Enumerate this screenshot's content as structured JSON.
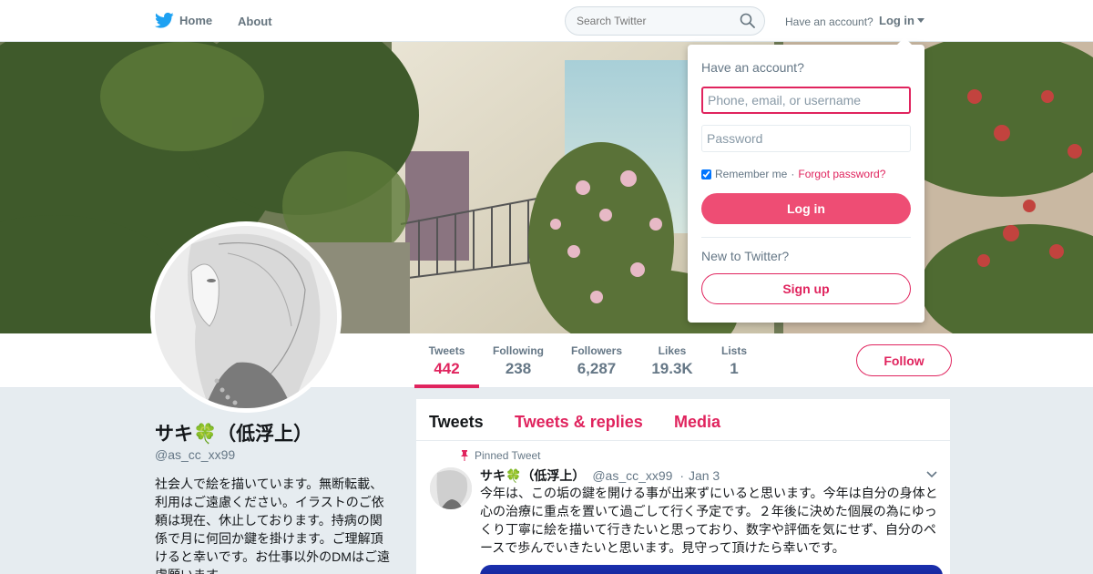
{
  "nav": {
    "home_label": "Home",
    "about_label": "About",
    "search_placeholder": "Search Twitter",
    "have_account": "Have an account?",
    "login_label": "Log in",
    "accent_color": "#1da1f2"
  },
  "stats": {
    "items": [
      {
        "label": "Tweets",
        "value": "442"
      },
      {
        "label": "Following",
        "value": "238"
      },
      {
        "label": "Followers",
        "value": "6,287"
      },
      {
        "label": "Likes",
        "value": "19.3K"
      },
      {
        "label": "Lists",
        "value": "1"
      }
    ],
    "follow_label": "Follow"
  },
  "profile": {
    "name": "サキ🍀（低浮上）",
    "handle": "@as_cc_xx99",
    "bio": "社会人で絵を描いています。無断転載、利用はご遠慮ください。イラストのご依頼は現在、休止しております。持病の関係で月に何回か鍵を掛けます。ご理解頂けると幸いです。お仕事以外のDMはご遠慮願います。"
  },
  "timeline": {
    "tabs": [
      "Tweets",
      "Tweets & replies",
      "Media"
    ],
    "pinned_label": "Pinned Tweet",
    "tweet": {
      "name": "サキ🍀（低浮上）",
      "handle": "@as_cc_xx99",
      "date": "Jan 3",
      "text": "今年は、この垢の鍵を開ける事が出来ずにいると思います。今年は自分の身体と心の治療に重点を置いて過ごして行く予定です。２年後に決めた個展の為にゆっくり丁寧に絵を描いて行きたいと思っており、数字や評価を気にせず、自分のペースで歩んでいきたいと思います。見守って頂けたら幸いです。"
    }
  },
  "login_dropdown": {
    "title": "Have an account?",
    "user_placeholder": "Phone, email, or username",
    "password_placeholder": "Password",
    "remember_label": "Remember me",
    "separator": " · ",
    "forgot_label": "Forgot password?",
    "login_button": "Log in",
    "new_label": "New to Twitter?",
    "signup_button": "Sign up"
  },
  "colors": {
    "brand_pink": "#e0245e",
    "login_button_bg": "#ee4d74",
    "text_secondary": "#657786"
  }
}
